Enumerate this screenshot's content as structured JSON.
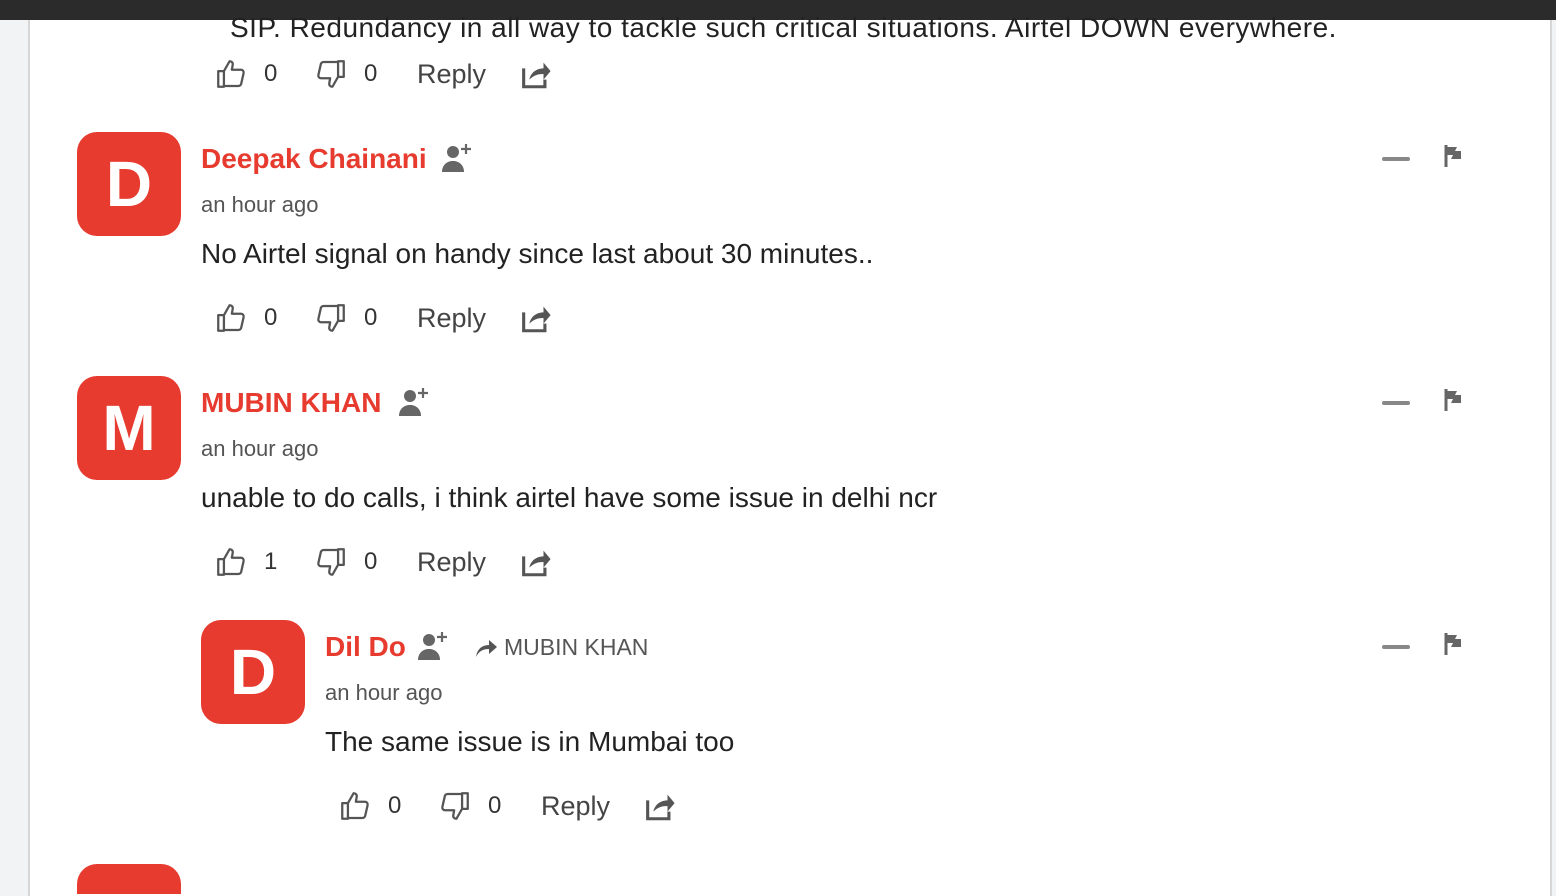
{
  "theme": {
    "accent": "#e63b2e",
    "topbar": "#2b2b2b"
  },
  "clipped_comment": {
    "text": "SIP. Redundancy in all way to tackle such critical situations. Airtel DOWN everywhere.",
    "likes": "0",
    "dislikes": "0",
    "reply_label": "Reply"
  },
  "comments": [
    {
      "initial": "D",
      "author": "Deepak Chainani",
      "time": "an hour ago",
      "text": "No Airtel signal on handy since last about 30 minutes..",
      "likes": "0",
      "dislikes": "0",
      "reply_label": "Reply"
    },
    {
      "initial": "M",
      "author": "MUBIN KHAN",
      "time": "an hour ago",
      "text": "unable to do calls, i think airtel have some issue in delhi ncr",
      "likes": "1",
      "dislikes": "0",
      "reply_label": "Reply"
    },
    {
      "initial": "D",
      "author": "Dil Do",
      "reply_to": "MUBIN KHAN",
      "time": "an hour ago",
      "text": "The same issue is in Mumbai too",
      "likes": "0",
      "dislikes": "0",
      "reply_label": "Reply"
    }
  ],
  "icons": {
    "like": "thumbs-up-icon",
    "dislike": "thumbs-down-icon",
    "share": "share-icon",
    "follow": "follow-user-icon",
    "collapse": "collapse-icon",
    "flag": "flag-icon",
    "reply_arrow": "reply-arrow-icon"
  }
}
